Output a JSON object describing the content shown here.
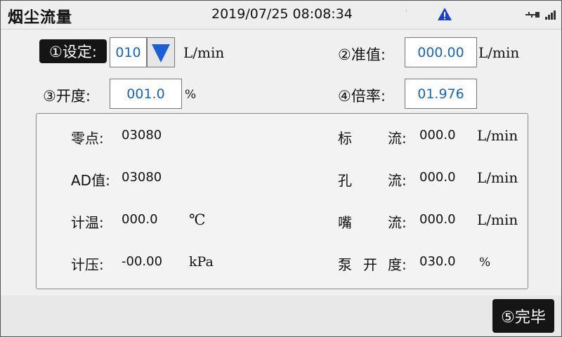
{
  "header": {
    "title": "烟尘流量",
    "datetime": "2019/07/25 08:08:34",
    "icons": [
      "warning-icon",
      "usb-icon",
      "signal-icon"
    ]
  },
  "settings": {
    "set_label": "①设定:",
    "set_value": "010",
    "set_unit": "L/min",
    "std_label": "②准值:",
    "std_value": "000.00",
    "std_unit": "L/min",
    "open_label": "③开度:",
    "open_value": "001.0",
    "open_unit": "%",
    "ratio_label": "④倍率:",
    "ratio_value": "01.976"
  },
  "readings": {
    "zero_label": "零点:",
    "zero_value": "03080",
    "ad_label": "AD值:",
    "ad_value": "03080",
    "temp_label": "计温:",
    "temp_value": "000.0",
    "temp_unit": "℃",
    "press_label": "计压:",
    "press_value": "-00.00",
    "press_unit": "kPa",
    "std_flow_label_a": "标",
    "std_flow_label_b": "流:",
    "std_flow_value": "000.0",
    "std_flow_unit": "L/min",
    "hole_flow_label_a": "孔",
    "hole_flow_label_b": "流:",
    "hole_flow_value": "000.0",
    "hole_flow_unit": "L/min",
    "nozzle_flow_label_a": "嘴",
    "nozzle_flow_label_b": "流:",
    "nozzle_flow_value": "000.0",
    "nozzle_flow_unit": "L/min",
    "pump_label_a": "泵",
    "pump_label_b": "开",
    "pump_label_c": "度:",
    "pump_value": "030.0",
    "pump_unit": "%"
  },
  "footer": {
    "done_label": "⑤完毕"
  },
  "colors": {
    "value_blue": "#1564c8",
    "accent_blue": "#1a5fd6",
    "label_bg": "#151515"
  }
}
